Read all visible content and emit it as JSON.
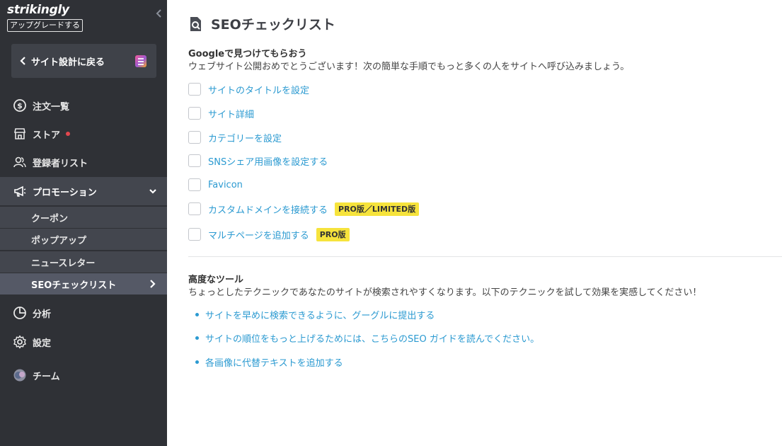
{
  "brand": {
    "logo_text": "strikingly",
    "upgrade_label": "アップグレードする"
  },
  "sidebar": {
    "back_label": "サイト設計に戻る",
    "items": [
      {
        "label": "注文一覧",
        "icon": "dollar-circle-icon"
      },
      {
        "label": "ストア",
        "icon": "store-icon",
        "has_notification": true
      },
      {
        "label": "登録者リスト",
        "icon": "users-icon"
      },
      {
        "label": "プロモーション",
        "icon": "megaphone-icon",
        "expanded": true
      },
      {
        "label": "分析",
        "icon": "pie-chart-icon"
      },
      {
        "label": "設定",
        "icon": "gear-icon"
      },
      {
        "label": "チーム",
        "icon": "avatar-icon"
      }
    ],
    "subitems": [
      {
        "label": "クーポン"
      },
      {
        "label": "ポップアップ"
      },
      {
        "label": "ニュースレター"
      },
      {
        "label": "SEOチェックリスト",
        "current": true
      }
    ]
  },
  "main": {
    "title": "SEOチェックリスト",
    "google_section": {
      "title": "Googleで見つけてもらおう",
      "description": "ウェブサイト公開おめでとうございます！次の簡単な手順でもっと多くの人をサイトへ呼び込みましょう。",
      "checklist": [
        {
          "label": "サイトのタイトルを設定",
          "checked": false
        },
        {
          "label": "サイト詳細",
          "checked": false
        },
        {
          "label": "カテゴリーを設定",
          "checked": false
        },
        {
          "label": "SNSシェア用画像を設定する",
          "checked": false
        },
        {
          "label": "Favicon",
          "checked": false
        },
        {
          "label": "カスタムドメインを接続する",
          "checked": false,
          "badge": "PRO版／LIMITED版"
        },
        {
          "label": "マルチページを追加する",
          "checked": false,
          "badge": "PRO版"
        }
      ]
    },
    "advanced_section": {
      "title": "高度なツール",
      "description": "ちょっとしたテクニックであなたのサイトが検索されやすくなります。以下のテクニックを試して効果を実感してください！",
      "links": [
        {
          "label": "サイトを早めに検索できるように、グーグルに提出する"
        },
        {
          "label": "サイトの順位をもっと上げるためには、こちらのSEO ガイドを読んでください。"
        },
        {
          "label": "各画像に代替テキストを追加する"
        }
      ]
    }
  },
  "colors": {
    "sidebar_bg": "#2f3136",
    "active_bg": "#43464e",
    "link": "#2b9ad1",
    "badge_bg": "#f6e33c",
    "notification": "#e2474e"
  }
}
